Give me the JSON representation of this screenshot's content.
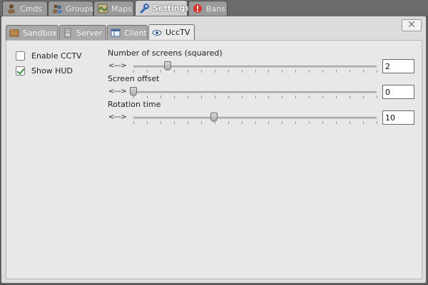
{
  "top_tabs": [
    {
      "label": "Cmds",
      "icon": "user-icon"
    },
    {
      "label": "Groups",
      "icon": "group-icon"
    },
    {
      "label": "Maps",
      "icon": "map-icon"
    },
    {
      "label": "Settings",
      "icon": "wrench-icon",
      "active": true
    },
    {
      "label": "Bans",
      "icon": "ban-icon"
    }
  ],
  "sub_tabs": [
    {
      "label": "Sandbox",
      "icon": "folder-icon"
    },
    {
      "label": "Server",
      "icon": "server-icon"
    },
    {
      "label": "Client",
      "icon": "window-icon"
    },
    {
      "label": "UccTV",
      "icon": "eye-icon",
      "active": true
    }
  ],
  "close_label": "✕",
  "checkboxes": [
    {
      "label": "Enable CCTV",
      "checked": false
    },
    {
      "label": "Show HUD",
      "checked": true
    }
  ],
  "sliders": [
    {
      "label": "Number of screens (squared)",
      "arrow": "<--->",
      "value": "2",
      "position": 0.14
    },
    {
      "label": "Screen offset",
      "arrow": "<--->",
      "value": "0",
      "position": 0.0
    },
    {
      "label": "Rotation time",
      "arrow": "<--->",
      "value": "10",
      "position": 0.33
    }
  ],
  "colors": {
    "accent_checked": "#3e8f3e",
    "ban_red": "#d9342b"
  }
}
